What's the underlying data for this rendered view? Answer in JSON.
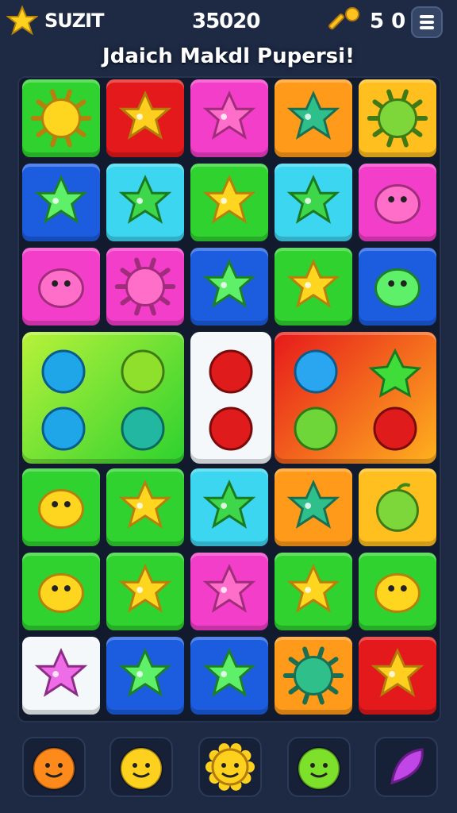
{
  "header": {
    "player_name": "SUZIT",
    "score": "35020",
    "coins": "5 0",
    "title": "Jdaich Makdl Pupersi!",
    "star_icon": "star-icon",
    "key_icon": "key-icon",
    "menu_icon": "menu-icon"
  },
  "colors": {
    "background": "#1e2a44",
    "green": "#2fd22f",
    "red": "#e3191b",
    "magenta": "#f23ec9",
    "orange": "#ff9a1a",
    "yellow": "#ffbf1f",
    "blue": "#1c5de0",
    "cyan": "#3dd6f0",
    "white": "#f4f8fb"
  },
  "board": {
    "rows": [
      [
        "green:sun",
        "red:star",
        "magenta:star",
        "orange:star",
        "yellow:sun"
      ],
      [
        "blue:star",
        "cyan:star",
        "green:star",
        "cyan:star",
        "magenta:blob"
      ],
      [
        "magenta:blob",
        "magenta:sun",
        "blue:star",
        "green:star",
        "blue:blob"
      ],
      [
        "merged-green",
        "merged-green",
        "merged-white",
        "merged-red",
        "merged-red"
      ],
      [
        "green:blob",
        "green:star",
        "cyan:star",
        "orange:star",
        "yellow:fruit"
      ],
      [
        "green:blob",
        "green:star",
        "magenta:star",
        "green:star",
        "green:blob"
      ],
      [
        "white:star",
        "blue:star",
        "blue:star",
        "orange:sun",
        "red:star"
      ]
    ],
    "special_tiles": [
      {
        "name": "green-merged",
        "items": [
          "bomb",
          "ball",
          "ball",
          "ball"
        ]
      },
      {
        "name": "white-merged",
        "items": [
          "apple",
          "apple"
        ]
      },
      {
        "name": "red-merged",
        "items": [
          "ball",
          "star",
          "ball",
          "apple"
        ]
      }
    ]
  },
  "tray": [
    {
      "name": "orange-face",
      "color": "#ff8a1c"
    },
    {
      "name": "yellow-face",
      "color": "#ffd11f"
    },
    {
      "name": "sun-face",
      "color": "#ffd11f"
    },
    {
      "name": "green-face",
      "color": "#7de02b"
    },
    {
      "name": "purple-leaf",
      "color": "#c046e6"
    }
  ]
}
